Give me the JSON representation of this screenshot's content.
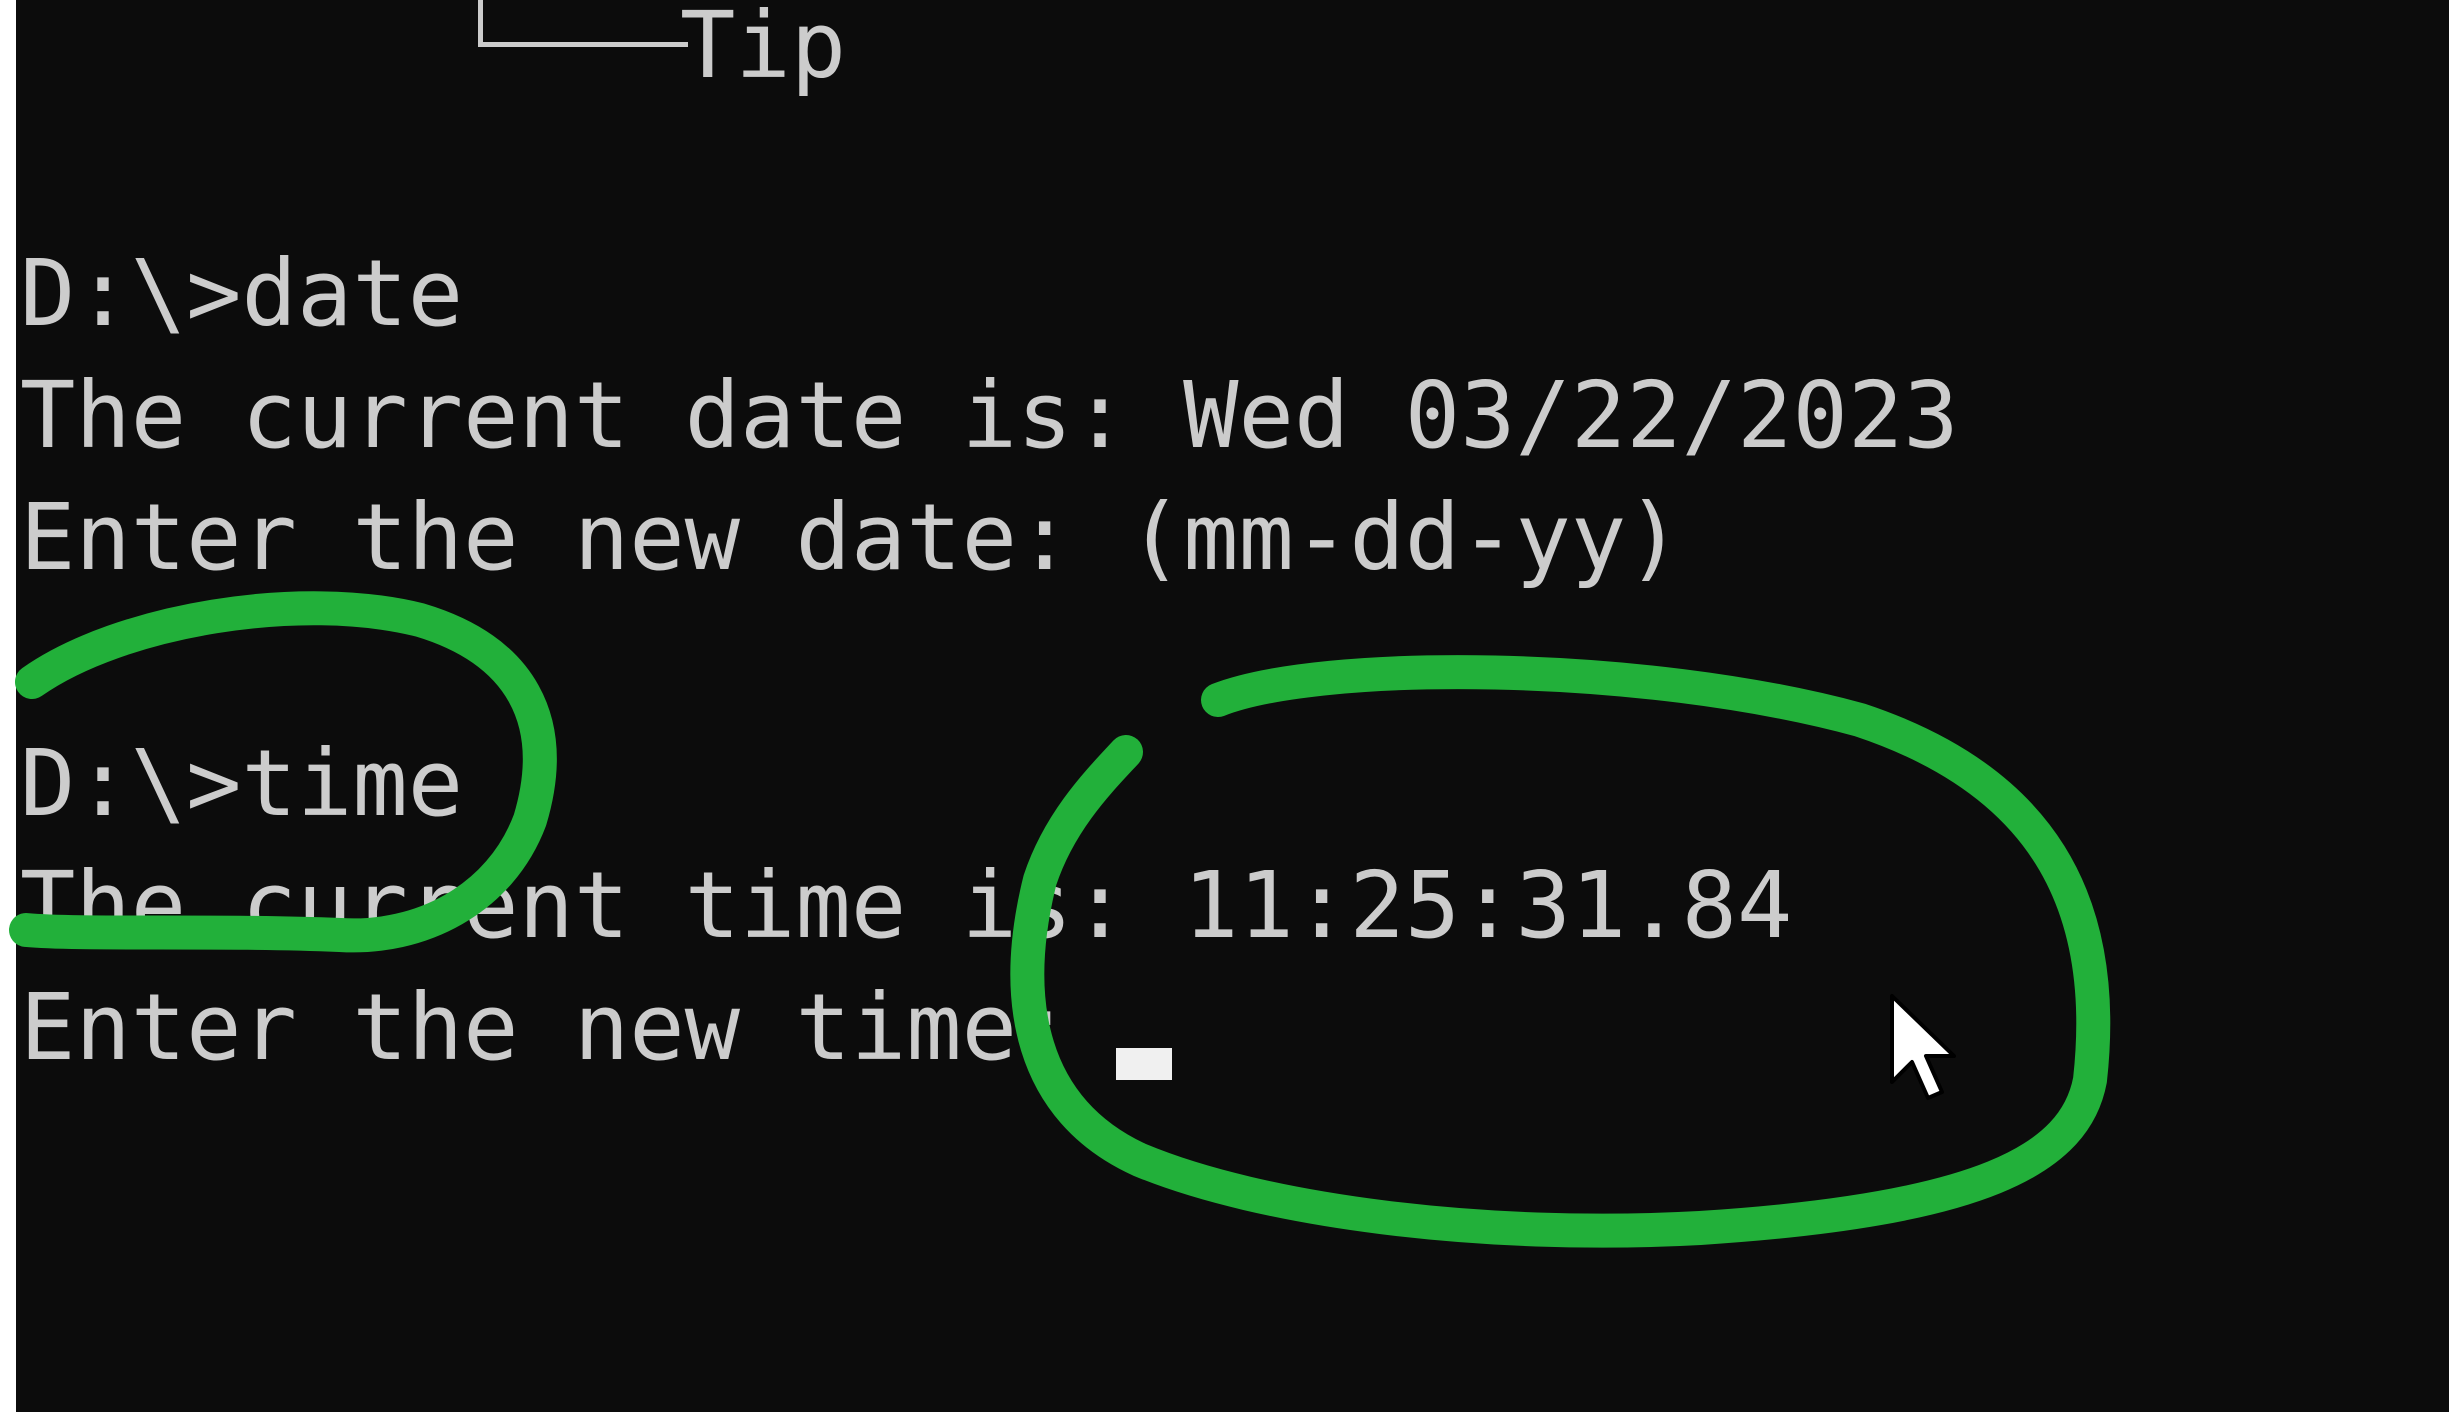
{
  "terminal": {
    "tree_label": "Tip",
    "lines": [
      "D:\\>date",
      "The current date is: Wed 03/22/2023",
      "Enter the new date: (mm-dd-yy)",
      "D:\\>time",
      "The current time is: 11:25:31.84",
      "Enter the new time:"
    ]
  },
  "colors": {
    "background": "#0c0c0c",
    "text": "#cccccc",
    "annotation": "#22b03a"
  },
  "icons": {
    "pointer": "mouse-pointer-icon",
    "caret": "text-cursor"
  }
}
